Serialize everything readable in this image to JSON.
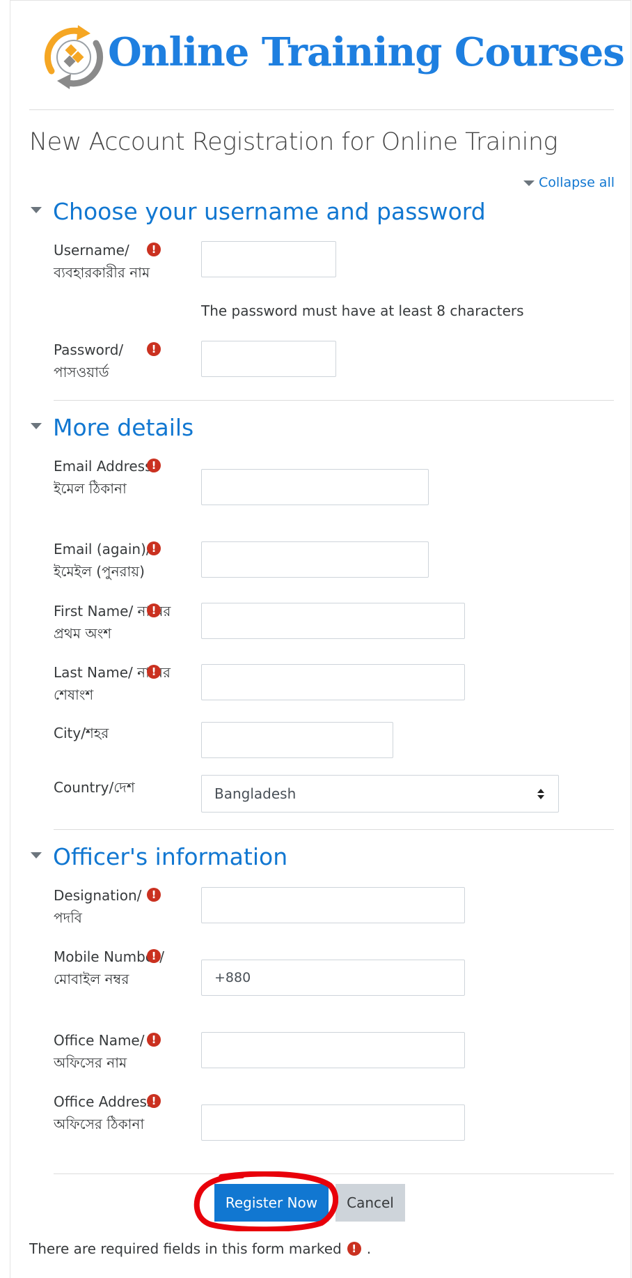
{
  "brand": {
    "name": "Online Training Courses",
    "color": "#1e7fe0"
  },
  "page_title": "New Account Registration for Online Training",
  "collapse_all": "Collapse all",
  "required_mark": "!",
  "sections": {
    "account": {
      "title": "Choose your username and password",
      "username_label": "Username/ ব্যবহারকারীর নাম",
      "password_hint": "The password must have at least 8 characters",
      "password_label": "Password/ পাসওয়ার্ড"
    },
    "details": {
      "title": "More details",
      "email_label": "Email Address/ ইমেল ঠিকানা",
      "email_again_label": "Email (again)/ ইমেইল (পুনরায়)",
      "first_name_label": "First Name/ নামের প্রথম অংশ",
      "last_name_label": "Last Name/ নামের শেষাংশ",
      "city_label": "City/শহর",
      "country_label": "Country/দেশ",
      "country_value": "Bangladesh"
    },
    "officer": {
      "title": "Officer's information",
      "designation_label": "Designation/ পদবি",
      "mobile_label": "Mobile Number/মোবাইল নম্বর",
      "mobile_value": "+880",
      "office_name_label": "Office Name/ অফিসের নাম",
      "office_address_label": "Office Address/ অফিসের ঠিকানা"
    }
  },
  "buttons": {
    "register": "Register Now",
    "cancel": "Cancel"
  },
  "footer_note": "There are required fields in this form marked",
  "footer_note_end": ".",
  "colors": {
    "link": "#1177d1",
    "required": "#ca3120",
    "annotation": "#e8000a"
  }
}
